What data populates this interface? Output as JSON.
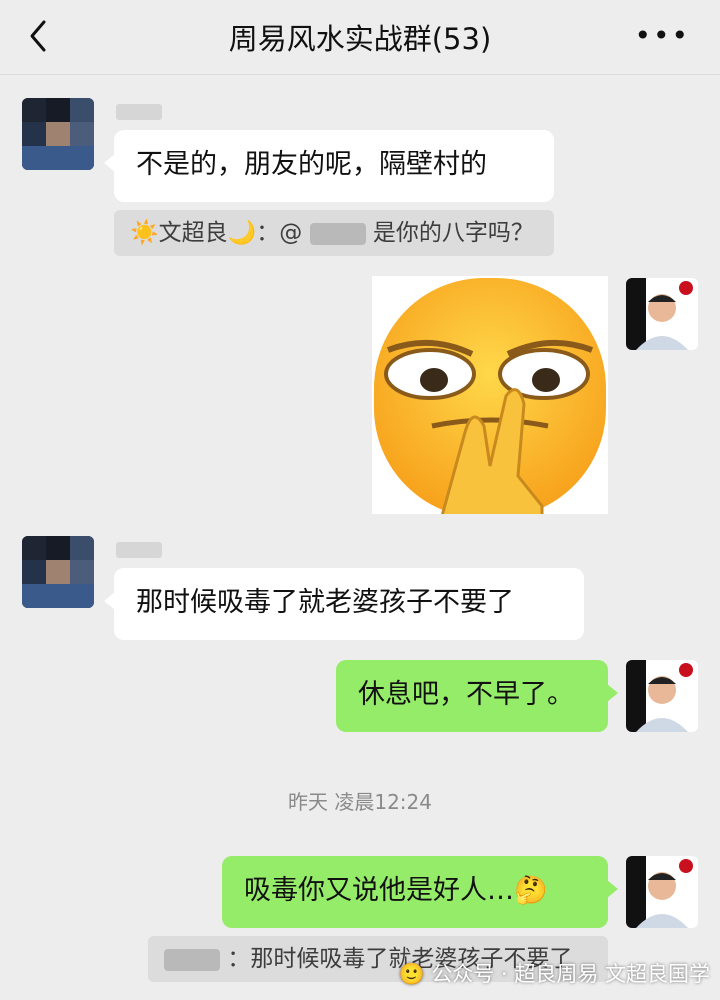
{
  "header": {
    "title": "周易风水实战群(53)",
    "back_icon": "chevron-left-icon",
    "more_label": "•••"
  },
  "messages": [
    {
      "side": "left",
      "text": "不是的，朋友的呢，隔壁村的"
    },
    {
      "side": "left",
      "quote": {
        "prefix": "☀️文超良🌙：@",
        "suffix": "是你的八字吗？"
      }
    },
    {
      "side": "right",
      "sticker": "smirk-emoji-peace-sign"
    },
    {
      "side": "left",
      "text": "那时候吸毒了就老婆孩子不要了"
    },
    {
      "side": "right",
      "text": "休息吧，不早了。"
    },
    {
      "side": "right",
      "text": "吸毒你又说他是好人…🤔"
    },
    {
      "side": "right",
      "quote": {
        "prefix": "",
        "suffix": "：那时候吸毒了就老婆孩子不要了"
      }
    }
  ],
  "timestamp": "昨天 凌晨12:24",
  "watermark": "🙂 公众号 · 超良周易 文超良国学",
  "colors": {
    "background": "#ededed",
    "self_bubble": "#95ec69",
    "other_bubble": "#ffffff"
  }
}
